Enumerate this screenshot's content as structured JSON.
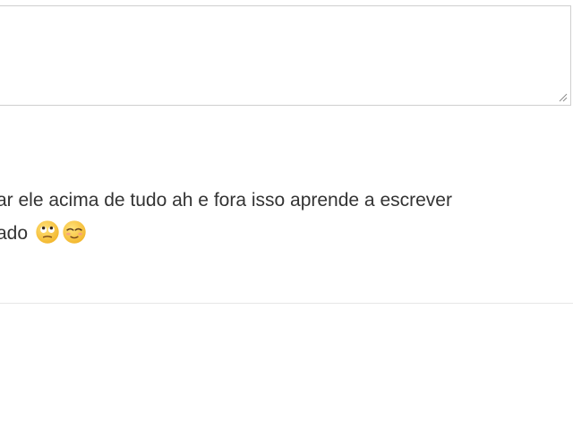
{
  "reply_box": {
    "value": "",
    "placeholder": ""
  },
  "comment": {
    "line1": "ar ele acima de tudo ah e fora isso aprende a escrever",
    "line2": "ado",
    "emojis": [
      "face-with-rolling-eyes-icon",
      "relieved-face-icon"
    ]
  },
  "colors": {
    "text": "#333333",
    "border": "#cfcfcf",
    "divider": "#e6e6e6",
    "emoji_yellow": "#f7c340"
  }
}
